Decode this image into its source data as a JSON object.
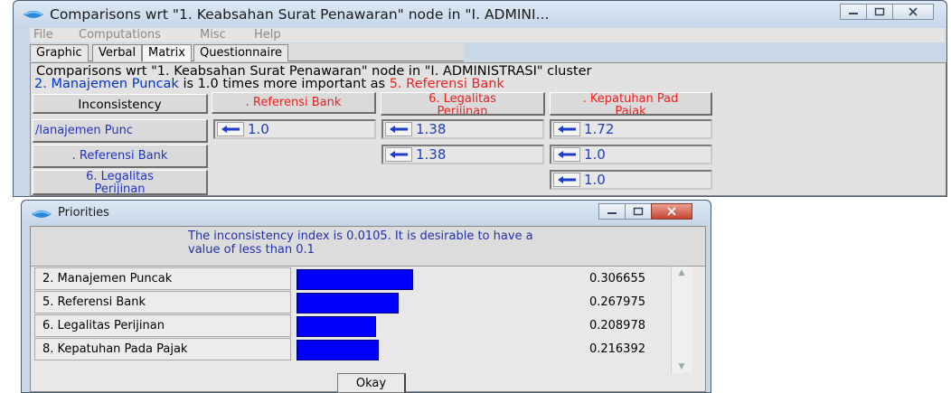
{
  "main_window": {
    "title": "Comparisons wrt \"1. Keabsahan Surat Penawaran\" node in \"I. ADMINI...",
    "menu": [
      "File",
      "Computations",
      "Misc",
      "Help"
    ],
    "tabs": [
      "Graphic",
      "Verbal",
      "Matrix",
      "Questionnaire"
    ],
    "active_tab": "Matrix",
    "comparison_text": "Comparisons wrt \"1. Keabsahan Surat Penawaran\" node in \"I. ADMINISTRASI\" cluster",
    "judgment": {
      "left": "2. Manajemen Puncak",
      "middle": " is 1.0 times more important as ",
      "right": "5. Referensi Bank"
    },
    "inconsistency_button": "Inconsistency",
    "column_headers": [
      ". Referensi Bank",
      "6. Legalitas\nPerijinan",
      ". Kepatuhan Pad\nPajak"
    ],
    "row_headers": [
      "/lanajemen Punc",
      ". Referensi Bank",
      "6. Legalitas\nPerijinan"
    ],
    "cells": {
      "r0c0": "1.0",
      "r0c1": "1.38",
      "r0c2": "1.72",
      "r1c1": "1.38",
      "r1c2": "1.0",
      "r2c2": "1.0"
    }
  },
  "priorities_window": {
    "title": "Priorities",
    "inconsistency_message": "The inconsistency index is 0.0105.  It is desirable to have a value of less than 0.1",
    "items": [
      {
        "label": "2. Manajemen Puncak",
        "value": "0.306655",
        "fraction": 0.306655
      },
      {
        "label": "5. Referensi Bank",
        "value": "0.267975",
        "fraction": 0.267975
      },
      {
        "label": "6. Legalitas Perijinan",
        "value": "0.208978",
        "fraction": 0.208978
      },
      {
        "label": "8. Kepatuhan Pada Pajak",
        "value": "0.216392",
        "fraction": 0.216392
      }
    ],
    "okay_button": "Okay"
  },
  "colors": {
    "bar": "#0000ff",
    "row_header_text": "#2034c4",
    "column_header_text": "#ee2020",
    "judgment_blue": "#0033cc",
    "judgment_red": "#ee2020"
  }
}
